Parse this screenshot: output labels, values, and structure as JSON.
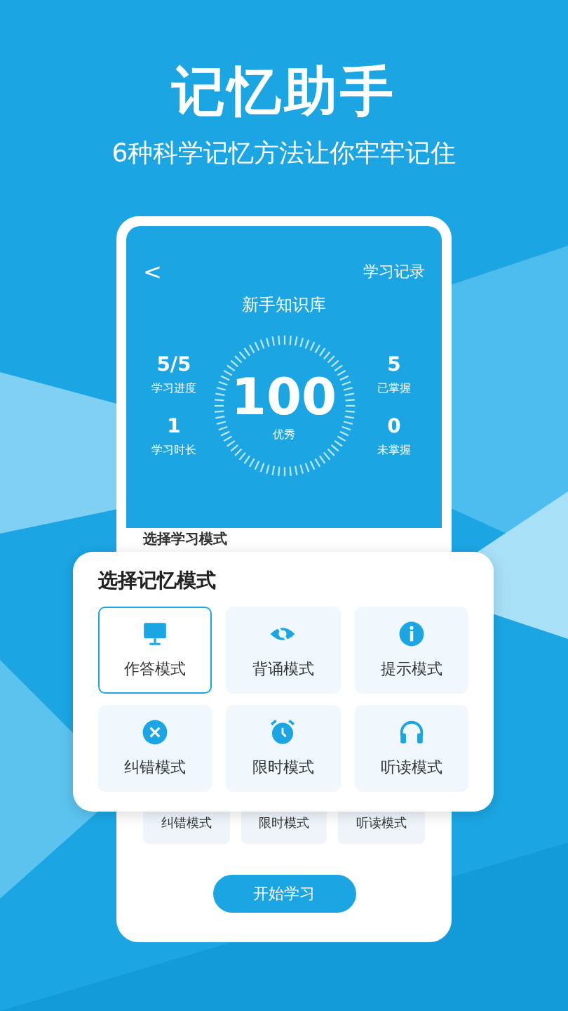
{
  "headline": "记忆助手",
  "subheadline": "6种科学记忆方法让你牢牢记住",
  "phone": {
    "header": {
      "back": "<",
      "link": "学习记录",
      "title": "新手知识库"
    },
    "score": {
      "value": "100",
      "grade": "优秀"
    },
    "stats_left": [
      {
        "value": "5/5",
        "label": "学习进度"
      },
      {
        "value": "1",
        "label": "学习时长"
      }
    ],
    "stats_right": [
      {
        "value": "5",
        "label": "已掌握"
      },
      {
        "value": "0",
        "label": "未掌握"
      }
    ],
    "section_title": "选择学习模式",
    "modes_row": [
      "纠错模式",
      "限时模式",
      "听读模式"
    ],
    "start_button": "开始学习"
  },
  "popup": {
    "title": "选择记忆模式",
    "modes": [
      {
        "kind": "monitor",
        "label": "作答模式",
        "selected": true
      },
      {
        "kind": "eye",
        "label": "背诵模式",
        "selected": false
      },
      {
        "kind": "info",
        "label": "提示模式",
        "selected": false
      },
      {
        "kind": "cross",
        "label": "纠错模式",
        "selected": false
      },
      {
        "kind": "clock",
        "label": "限时模式",
        "selected": false
      },
      {
        "kind": "headphones",
        "label": "听读模式",
        "selected": false
      }
    ]
  }
}
